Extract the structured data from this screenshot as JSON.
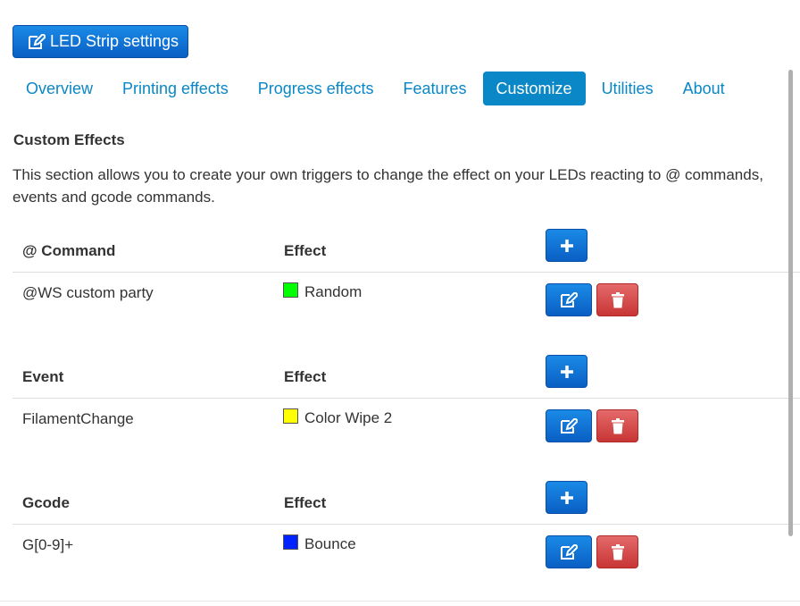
{
  "header": {
    "title_button_label": "LED Strip settings"
  },
  "tabs": [
    {
      "label": "Overview"
    },
    {
      "label": "Printing effects"
    },
    {
      "label": "Progress effects"
    },
    {
      "label": "Features"
    },
    {
      "label": "Customize"
    },
    {
      "label": "Utilities"
    },
    {
      "label": "About"
    }
  ],
  "active_tab": "Customize",
  "section": {
    "title": "Custom Effects",
    "description": "This section allows you to create your own triggers to change the effect on your LEDs reacting to @ commands, events and gcode commands."
  },
  "tables": [
    {
      "col1_header": "@ Command",
      "col2_header": "Effect",
      "row": {
        "trigger": "@WS custom party",
        "effect": "Random",
        "color": "#00ff00"
      }
    },
    {
      "col1_header": "Event",
      "col2_header": "Effect",
      "row": {
        "trigger": "FilamentChange",
        "effect": "Color Wipe 2",
        "color": "#ffff00"
      }
    },
    {
      "col1_header": "Gcode",
      "col2_header": "Effect",
      "row": {
        "trigger": "G[0-9]+",
        "effect": "Bounce",
        "color": "#0022ff"
      }
    }
  ],
  "icons": {
    "title_button": "edit-icon",
    "add": "plus-icon",
    "edit": "edit-icon",
    "delete": "trash-icon"
  }
}
